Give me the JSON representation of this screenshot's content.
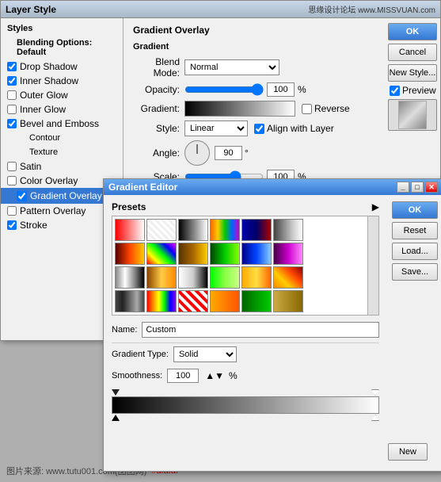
{
  "layerStylePanel": {
    "title": "Layer Style",
    "watermark": "www.missvuan.com",
    "sidebar": {
      "stylesLabel": "Styles",
      "blendingOptions": "Blending Options: Default",
      "items": [
        {
          "label": "Drop Shadow",
          "checked": true
        },
        {
          "label": "Inner Shadow",
          "checked": true
        },
        {
          "label": "Outer Glow",
          "checked": false
        },
        {
          "label": "Inner Glow",
          "checked": false
        },
        {
          "label": "Bevel and Emboss",
          "checked": true
        },
        {
          "label": "Contour",
          "checked": false
        },
        {
          "label": "Texture",
          "checked": false
        },
        {
          "label": "Satin",
          "checked": false
        },
        {
          "label": "Color Overlay",
          "checked": false
        },
        {
          "label": "Gradient Overlay",
          "checked": true,
          "active": true
        },
        {
          "label": "Pattern Overlay",
          "checked": false
        },
        {
          "label": "Stroke",
          "checked": true
        }
      ]
    },
    "gradientOverlay": {
      "title": "Gradient Overlay",
      "gradientSubtitle": "Gradient",
      "blendModeLabel": "Blend Mode:",
      "blendModeValue": "Normal",
      "opacityLabel": "Opacity:",
      "opacityValue": "100",
      "opacityUnit": "%",
      "gradientLabel": "Gradient:",
      "reverseLabel": "Reverse",
      "styleLabel": "Style:",
      "styleValue": "Linear",
      "alignWithLayerLabel": "Align with Layer",
      "angleLabel": "Angle:",
      "angleDegValue": "90",
      "angleDegUnit": "°",
      "scaleLabel": "Scale:",
      "scaleValue": "100",
      "scaleUnit": "%"
    },
    "buttons": {
      "ok": "OK",
      "cancel": "Cancel",
      "newStyle": "New Style...",
      "preview": "Preview"
    }
  },
  "gradientEditor": {
    "title": "Gradient Editor",
    "presetsLabel": "Presets",
    "nameLabel": "Name:",
    "nameValue": "Custom",
    "gradientTypeLabel": "Gradient Type:",
    "gradientTypeValue": "Solid",
    "smoothnessLabel": "Smoothness:",
    "smoothnessValue": "100",
    "smoothnessUnit": "%",
    "buttons": {
      "ok": "OK",
      "reset": "Reset",
      "load": "Load...",
      "save": "Save...",
      "new": "New"
    }
  },
  "watermark": {
    "text": "图片来源: www.tutu001.com(图图网)",
    "colorText": "#afafaf"
  }
}
